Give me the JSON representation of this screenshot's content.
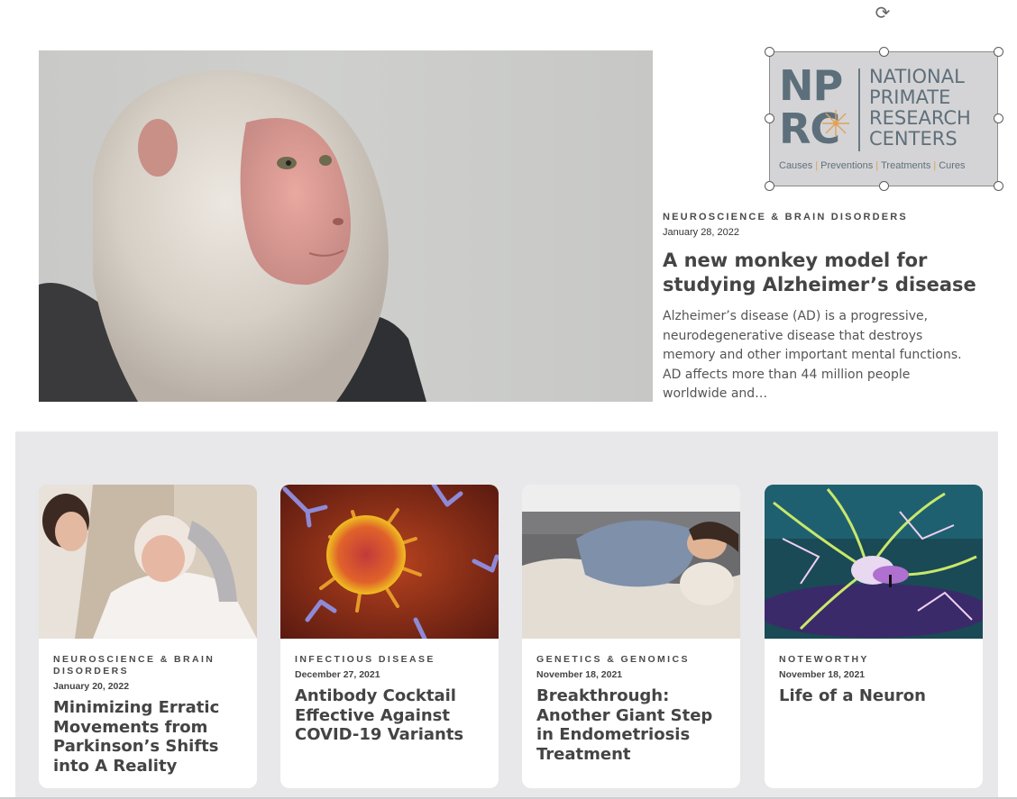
{
  "feature": {
    "category": "NEUROSCIENCE & BRAIN DISORDERS",
    "date": "January 28, 2022",
    "title": "A new monkey model for studying Alzheimer’s disease",
    "excerpt": "Alzheimer’s disease (AD) is a progressive, neurodegenerative disease that destroys memory and other important mental functions. AD affects more than 44 million people worldwide and…"
  },
  "logo": {
    "initials_top": "NP",
    "initials_bottom": "RC",
    "name_lines": [
      "NATIONAL",
      "PRIMATE",
      "RESEARCH",
      "CENTERS"
    ],
    "tagline": [
      "Causes",
      "Preventions",
      "Treatments",
      "Cures"
    ]
  },
  "cards": [
    {
      "category": "NEUROSCIENCE & BRAIN DISORDERS",
      "date": "January 20, 2022",
      "title": "Minimizing Erratic Movements from Parkinson’s Shifts into A Reality"
    },
    {
      "category": "INFECTIOUS DISEASE",
      "date": "December 27, 2021",
      "title": "Antibody Cocktail Effective Against COVID-19 Variants"
    },
    {
      "category": "GENETICS & GENOMICS",
      "date": "November 18, 2021",
      "title": "Breakthrough: Another Giant Step in Endometriosis Treatment"
    },
    {
      "category": "NOTEWORTHY",
      "date": "November 18, 2021",
      "title": "Life of a Neuron"
    }
  ],
  "colors": {
    "logo_accent": "#e0a25a",
    "section_background": "#e8e8ea"
  },
  "icons": {
    "rotate": "rotate-icon"
  }
}
